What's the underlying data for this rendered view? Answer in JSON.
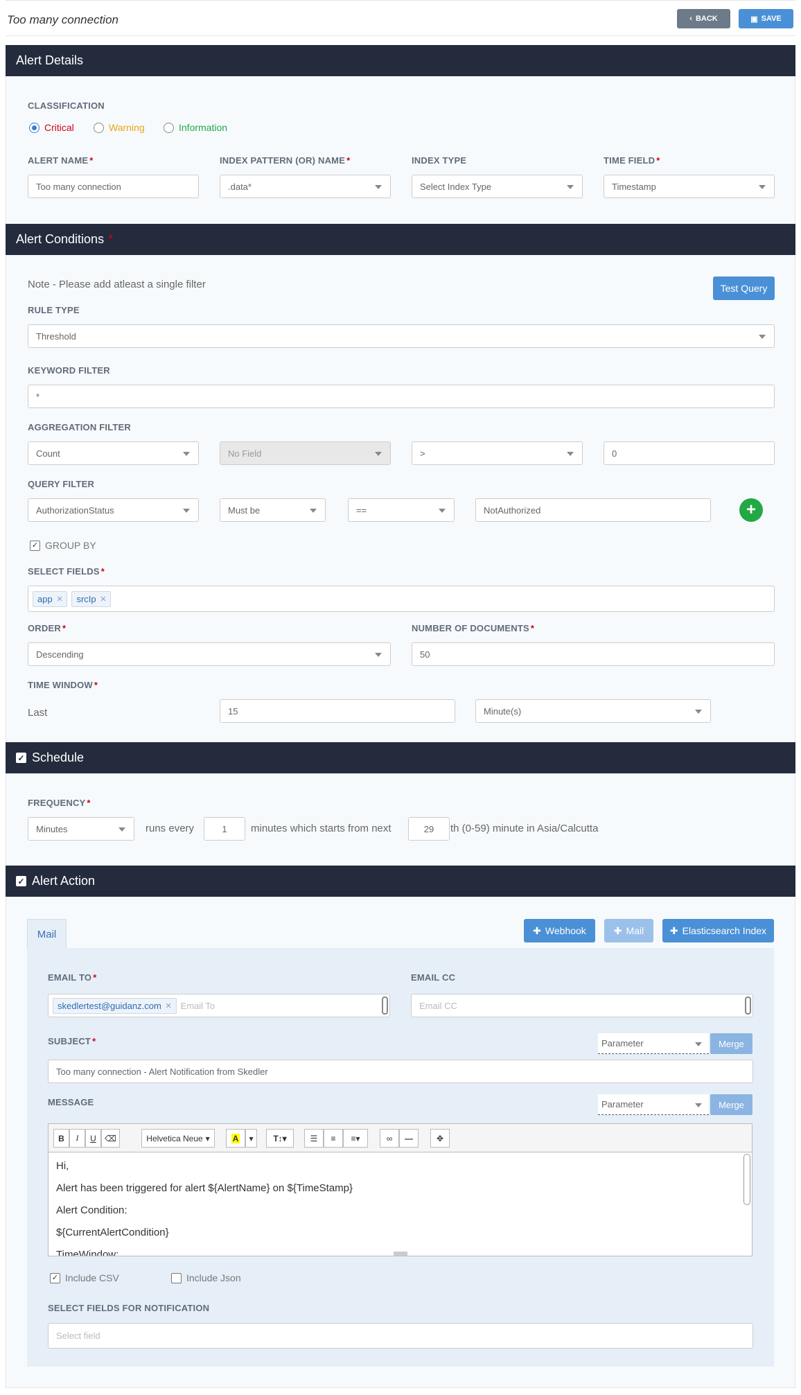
{
  "header": {
    "title": "Too many connection",
    "back_label": "BACK",
    "save_label": "SAVE"
  },
  "alert_details": {
    "heading": "Alert Details",
    "classification_label": "CLASSIFICATION",
    "classifications": [
      {
        "label": "Critical",
        "color": "#d0021b",
        "selected": true
      },
      {
        "label": "Warning",
        "color": "#e8a317",
        "selected": false
      },
      {
        "label": "Information",
        "color": "#22a845",
        "selected": false
      }
    ],
    "alert_name_label": "ALERT NAME",
    "alert_name_value": "Too many connection",
    "index_pattern_label": "INDEX PATTERN (OR) NAME",
    "index_pattern_value": ".data*",
    "index_type_label": "INDEX TYPE",
    "index_type_value": "Select Index Type",
    "time_field_label": "TIME FIELD",
    "time_field_value": "Timestamp"
  },
  "alert_conditions": {
    "heading": "Alert Conditions",
    "note": "Note - Please add atleast a single filter",
    "test_query_label": "Test Query",
    "rule_type_label": "RULE TYPE",
    "rule_type_value": "Threshold",
    "keyword_filter_label": "KEYWORD FILTER",
    "keyword_filter_value": "*",
    "aggregation_filter_label": "AGGREGATION FILTER",
    "aggregation": {
      "function": "Count",
      "field": "No Field",
      "operator": ">",
      "value": "0"
    },
    "query_filter_label": "QUERY FILTER",
    "query": {
      "field": "AuthorizationStatus",
      "condition": "Must be",
      "operator": "==",
      "value": "NotAuthorized"
    },
    "group_by_label": "GROUP BY",
    "select_fields_label": "SELECT FIELDS",
    "select_fields": [
      "app",
      "srcIp"
    ],
    "order_label": "ORDER",
    "order_value": "Descending",
    "num_docs_label": "NUMBER OF DOCUMENTS",
    "num_docs_value": "50",
    "time_window_label": "TIME WINDOW",
    "last_label": "Last",
    "time_window_value": "15",
    "time_window_unit": "Minute(s)"
  },
  "schedule": {
    "heading": "Schedule",
    "frequency_label": "FREQUENCY",
    "frequency_value": "Minutes",
    "runs_every": "runs  every",
    "interval": "1",
    "minutes_text": "minutes  which starts from next",
    "start_minute": "29",
    "suffix": "th (0-59) minute in  Asia/Calcutta"
  },
  "alert_action": {
    "heading": "Alert Action",
    "tab_mail": "Mail",
    "webhook_label": "Webhook",
    "mail_label": "Mail",
    "es_index_label": "Elasticsearch Index",
    "email_to_label": "EMAIL TO",
    "email_to_tags": [
      "skedlertest@guidanz.com"
    ],
    "email_to_placeholder": "Email To",
    "email_cc_label": "EMAIL CC",
    "email_cc_placeholder": "Email CC",
    "subject_label": "SUBJECT",
    "subject_value": "Too many connection - Alert Notification from Skedler",
    "parameter_label": "Parameter",
    "merge_label": "Merge",
    "message_label": "MESSAGE",
    "font_name": "Helvetica Neue",
    "message_lines": [
      "Hi,",
      "Alert has been triggered for alert ${AlertName} on ${TimeStamp}",
      "Alert Condition:",
      "${CurrentAlertCondition}",
      "TimeWindow:"
    ],
    "include_csv_label": "Include CSV",
    "include_json_label": "Include Json",
    "select_fields_notification_label": "SELECT FIELDS FOR NOTIFICATION",
    "select_field_placeholder": "Select field"
  }
}
